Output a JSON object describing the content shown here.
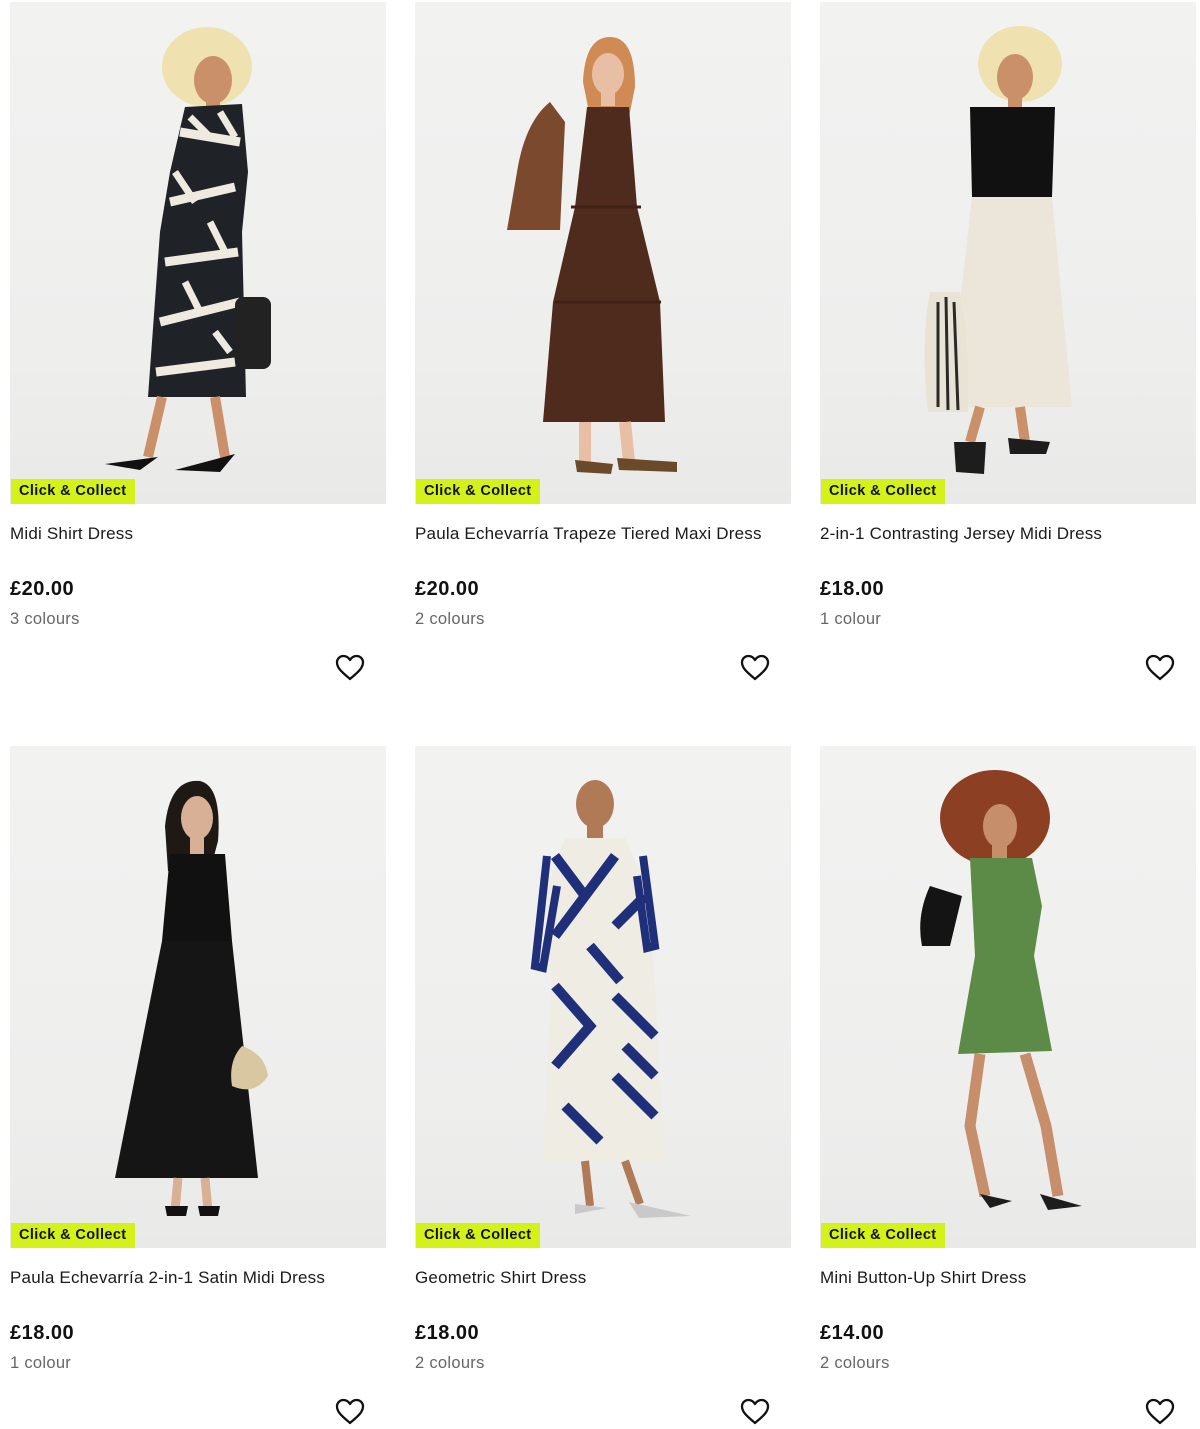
{
  "products": [
    {
      "badge": "Click & Collect",
      "name": "Midi Shirt Dress",
      "price": "£20.00",
      "colours": "3 colours"
    },
    {
      "badge": "Click & Collect",
      "name": "Paula Echevarría Trapeze Tiered Maxi Dress",
      "price": "£20.00",
      "colours": "2 colours"
    },
    {
      "badge": "Click & Collect",
      "name": "2-in-1 Contrasting Jersey Midi Dress",
      "price": "£18.00",
      "colours": "1 colour"
    },
    {
      "badge": "Click & Collect",
      "name": "Paula Echevarría 2-in-1 Satin Midi Dress",
      "price": "£18.00",
      "colours": "1 colour"
    },
    {
      "badge": "Click & Collect",
      "name": "Geometric Shirt Dress",
      "price": "£18.00",
      "colours": "2 colours"
    },
    {
      "badge": "Click & Collect",
      "name": "Mini Button-Up Shirt Dress",
      "price": "£14.00",
      "colours": "2 colours"
    }
  ],
  "icons": {
    "wishlist": "heart-outline-icon"
  },
  "colors": {
    "badge_bg": "#d4f11a",
    "price": "#111111",
    "colours_text": "#666666"
  }
}
